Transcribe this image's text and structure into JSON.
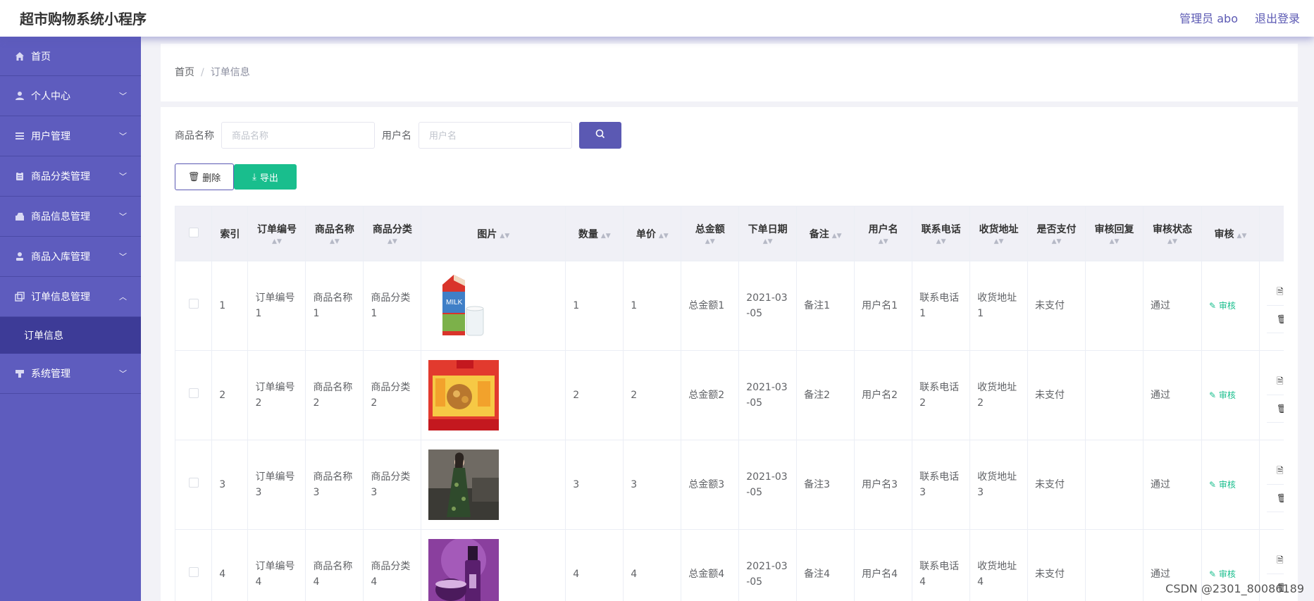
{
  "header": {
    "title": "超市购物系统小程序",
    "admin_label": "管理员 abo",
    "logout_label": "退出登录"
  },
  "sidebar": {
    "items": [
      {
        "label": "首页",
        "icon": "home-icon"
      },
      {
        "label": "个人中心",
        "icon": "user-icon"
      },
      {
        "label": "用户管理",
        "icon": "list-icon"
      },
      {
        "label": "商品分类管理",
        "icon": "clipboard-icon"
      },
      {
        "label": "商品信息管理",
        "icon": "box-icon"
      },
      {
        "label": "商品入库管理",
        "icon": "person-icon"
      },
      {
        "label": "订单信息管理",
        "icon": "copy-icon"
      },
      {
        "label": "系统管理",
        "icon": "stamp-icon"
      }
    ],
    "active_sub": "订单信息"
  },
  "breadcrumb": {
    "home": "首页",
    "separator": "/",
    "current": "订单信息"
  },
  "search": {
    "product_label": "商品名称",
    "product_placeholder": "商品名称",
    "user_label": "用户名",
    "user_placeholder": "用户名"
  },
  "actions": {
    "delete_label": "删除",
    "export_label": "导出"
  },
  "table": {
    "headers": {
      "index": "索引",
      "order_no": "订单编号",
      "product_name": "商品名称",
      "category": "商品分类",
      "image": "图片",
      "qty": "数量",
      "price": "单价",
      "total": "总金额",
      "date": "下单日期",
      "note": "备注",
      "username": "用户名",
      "phone": "联系电话",
      "address": "收货地址",
      "paid": "是否支付",
      "reply": "审核回复",
      "status": "审核状态",
      "audit": "审核"
    },
    "rows": [
      {
        "index": "1",
        "order_no": "订单编号1",
        "product_name": "商品名称1",
        "category": "商品分类1",
        "image": "milk-carton-image",
        "qty": "1",
        "price": "1",
        "total": "总金额1",
        "date": "2021-03-05",
        "note": "备注1",
        "username": "用户名1",
        "phone": "联系电话1",
        "address": "收货地址1",
        "paid": "未支付",
        "reply": "",
        "status": "通过",
        "audit": "审核",
        "detail": "详情",
        "delete": "删除"
      },
      {
        "index": "2",
        "order_no": "订单编号2",
        "product_name": "商品名称2",
        "category": "商品分类2",
        "image": "snack-box-image",
        "qty": "2",
        "price": "2",
        "total": "总金额2",
        "date": "2021-03-05",
        "note": "备注2",
        "username": "用户名2",
        "phone": "联系电话2",
        "address": "收货地址2",
        "paid": "未支付",
        "reply": "",
        "status": "通过",
        "audit": "审核",
        "detail": "详情",
        "delete": "删除"
      },
      {
        "index": "3",
        "order_no": "订单编号3",
        "product_name": "商品名称3",
        "category": "商品分类3",
        "image": "dress-photo-image",
        "qty": "3",
        "price": "3",
        "total": "总金额3",
        "date": "2021-03-05",
        "note": "备注3",
        "username": "用户名3",
        "phone": "联系电话3",
        "address": "收货地址3",
        "paid": "未支付",
        "reply": "",
        "status": "通过",
        "audit": "审核",
        "detail": "详情",
        "delete": "删除"
      },
      {
        "index": "4",
        "order_no": "订单编号4",
        "product_name": "商品名称4",
        "category": "商品分类4",
        "image": "cosmetics-image",
        "qty": "4",
        "price": "4",
        "total": "总金额4",
        "date": "2021-03-05",
        "note": "备注4",
        "username": "用户名4",
        "phone": "联系电话4",
        "address": "收货地址4",
        "paid": "未支付",
        "reply": "",
        "status": "通过",
        "audit": "审核",
        "detail": "详情",
        "delete": "删除"
      }
    ]
  },
  "watermark": "CSDN @2301_80086189",
  "colors": {
    "primary": "#5b59b3",
    "sidebar": "#5e5cbe",
    "sidebar_active": "#3d3b97",
    "success": "#19be8d"
  }
}
